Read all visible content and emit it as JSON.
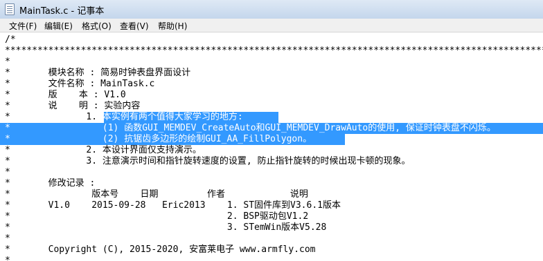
{
  "window": {
    "title": "MainTask.c - 记事本"
  },
  "menu": {
    "items": [
      "文件(F)",
      "编辑(E)",
      "格式(O)",
      "查看(V)",
      "帮助(H)"
    ]
  },
  "editor": {
    "lines": [
      "/*",
      "*****************************************************************************************************************",
      "*",
      "*       模块名称 : 简易时钟表盘界面设计",
      "*       文件名称 : MainTask.c",
      "*       版    本 : V1.0",
      "*       说    明 : 实验内容",
      "*              1. 本实例有两个值得大家学习的地方:",
      "*                 (1) 函数GUI_MEMDEV_CreateAuto和GUI_MEMDEV_DrawAuto的使用, 保证时钟表盘不闪烁。",
      "*                 (2) 抗锯齿多边形的绘制GUI_AA_FillPolygon。",
      "*              2. 本设计界面仅支持演示。",
      "*              3. 注意演示时间和指针旋转速度的设置, 防止指针旋转的时候出现卡顿的现象。",
      "*",
      "*       修改记录 :",
      "*               版本号    日期         作者            说明",
      "*       V1.0    2015-09-28   Eric2013    1. ST固件库到V3.6.1版本",
      "*                                        2. BSP驱动包V1.2",
      "*                                        3. STemWin版本V5.28",
      "*",
      "*       Copyright (C), 2015-2020, 安富莱电子 www.armfly.com",
      "*"
    ],
    "selection": {
      "line7_selected": "本实例有两个值得大家学习的地方:",
      "line8_selected": "(1) 函数GUI_MEMDEV_CreateAuto和GUI_MEMDEV_DrawAuto的使用, 保证时钟表盘不闪烁。",
      "line9_selected": "(2) 抗锯齿多边形的绘制GUI_AA_FillPolygon。"
    },
    "selection_color": "#3399ff"
  }
}
